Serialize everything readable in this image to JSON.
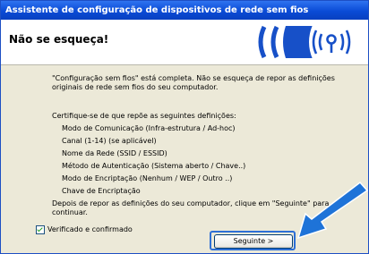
{
  "window": {
    "title": "Assistente de configuração de dispositivos de rede sem fios"
  },
  "header": {
    "title": "Não se esqueça!"
  },
  "content": {
    "intro_line1": "\"Configuração sem fios\" está completa. Não se esqueça de repor as definições",
    "intro_line2": "originais de rede sem fios do seu computador.",
    "check_prompt": "Certifique-se de que repõe as seguintes definições:",
    "settings": [
      "Modo de Comunicação (Infra-estrutura / Ad-hoc)",
      "Canal (1-14) (se aplicável)",
      "Nome da Rede (SSID / ESSID)",
      "Método de Autenticação (Sistema aberto / Chave..)",
      "Modo de Encriptação (Nenhum / WEP / Outro ..)",
      "Chave de Encriptação"
    ],
    "next_line1": "Depois de repor as definições do seu computador, clique em \"Seguinte\" para",
    "next_line2": "continuar.",
    "checkbox_label": "Verificado e confirmado"
  },
  "buttons": {
    "next_label": "Seguinte >"
  },
  "colors": {
    "titlebar": "#0a4bd6",
    "dialog_bg": "#ECE9D8",
    "arrow": "#1e73d8",
    "logo": "#1750c8"
  },
  "icons": {
    "logo": "wireless-signal-logo",
    "arrow": "pointer-arrow"
  }
}
